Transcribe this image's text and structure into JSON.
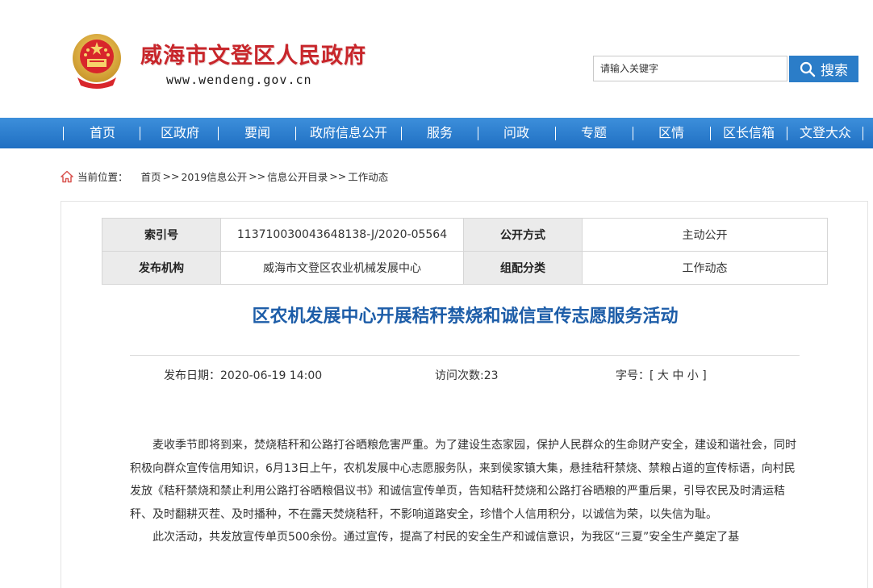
{
  "header": {
    "site_title": "威海市文登区人民政府",
    "site_url": "www.wendeng.gov.cn",
    "search_placeholder": "请输入关键字",
    "search_button": "搜索"
  },
  "nav": [
    "首页",
    "区政府",
    "要闻",
    "政府信息公开",
    "服务",
    "问政",
    "专题",
    "区情",
    "区长信箱",
    "文登大众"
  ],
  "breadcrumb": {
    "label": "当前位置：",
    "items": [
      "首页",
      "2019信息公开",
      "信息公开目录",
      "工作动态"
    ],
    "separator": ">>"
  },
  "meta": {
    "index_label": "索引号",
    "index_value": "113710030043648138-J/2020-05564",
    "open_label": "公开方式",
    "open_value": "主动公开",
    "publisher_label": "发布机构",
    "publisher_value": "威海市文登区农业机械发展中心",
    "category_label": "组配分类",
    "category_value": "工作动态"
  },
  "article": {
    "title": "区农机发展中心开展秸秆禁烧和诚信宣传志愿服务活动",
    "publish_date": "发布日期：2020-06-19 14:00",
    "visits": "访问次数:23",
    "font_size": "字号：[ 大 中 小 ]",
    "paragraph1": "麦收季节即将到来，焚烧秸秆和公路打谷晒粮危害严重。为了建设生态家园，保护人民群众的生命财产安全，建设和谐社会，同时积极向群众宣传信用知识，6月13日上午，农机发展中心志愿服务队，来到侯家镇大集，悬挂秸秆禁烧、禁粮占道的宣传标语，向村民发放《秸秆禁烧和禁止利用公路打谷晒粮倡议书》和诚信宣传单页，告知秸秆焚烧和公路打谷晒粮的严重后果，引导农民及时清运秸秆、及时翻耕灭茬、及时播种，不在露天焚烧秸秆，不影响道路安全，珍惜个人信用积分，以诚信为荣，以失信为耻。",
    "paragraph2": "此次活动，共发放宣传单页500余份。通过宣传，提高了村民的安全生产和诚信意识，为我区“三夏”安全生产奠定了基"
  },
  "colors": {
    "title_red": "#c8262b",
    "nav_blue": "#2b7dc8",
    "article_title_blue": "#1d5da8"
  }
}
